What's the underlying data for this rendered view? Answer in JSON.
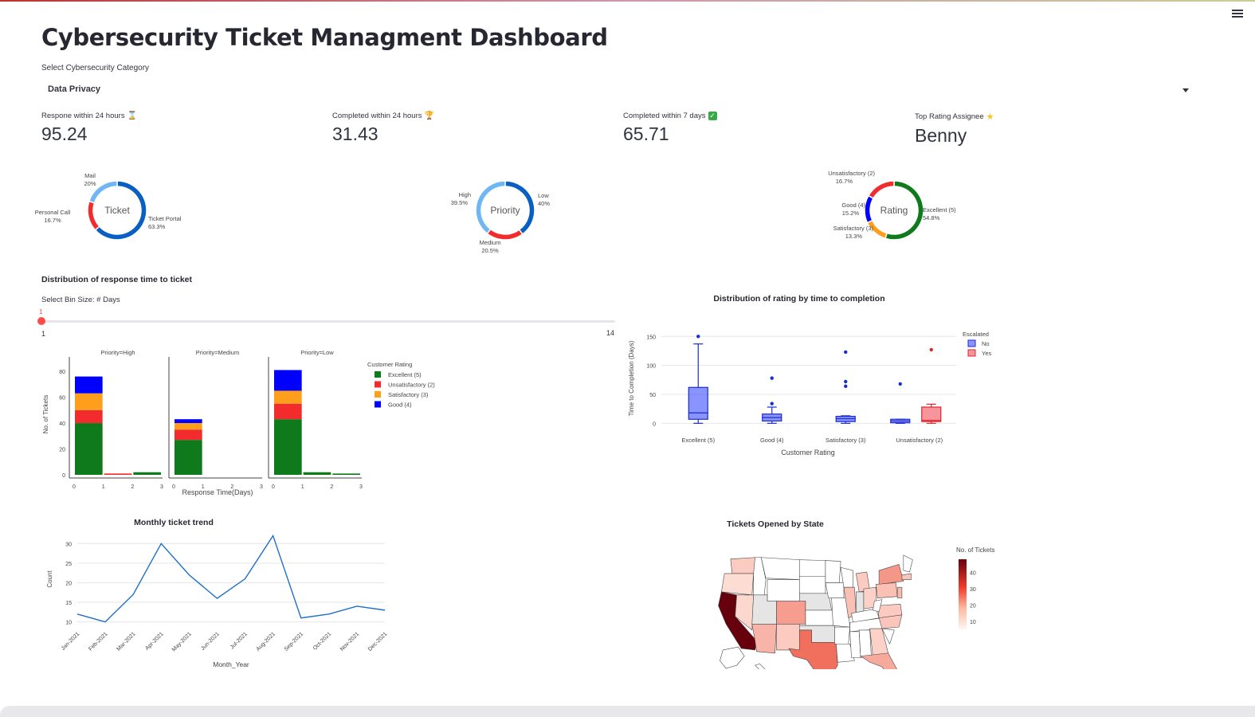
{
  "app": {
    "title": "Cybersecurity Ticket Managment Dashboard"
  },
  "icons": {
    "menu": "hamburger-menu-icon",
    "hourglass": "hourglass-icon",
    "trophy": "trophy-icon",
    "check": "check-mark-icon",
    "star": "star-icon",
    "caret": "chevron-down-icon"
  },
  "filter": {
    "label": "Select Cybersecurity Category",
    "value": "Data Privacy"
  },
  "metrics": [
    {
      "label": "Respone within 24 hours",
      "value": "95.24",
      "icon": "hourglass-icon"
    },
    {
      "label": "Completed within 24 hours",
      "value": "31.43",
      "icon": "trophy-icon"
    },
    {
      "label": "Completed within 7 days",
      "value": "65.71",
      "icon": "check-mark-icon"
    },
    {
      "label": "Top Rating Assignee",
      "value": "Benny",
      "icon": "star-icon"
    }
  ],
  "section": {
    "response_title": "Distribution of response time to ticket"
  },
  "slider": {
    "label": "Select Bin Size: # Days",
    "value": "1",
    "min": "1",
    "max": "14",
    "fraction": 0
  },
  "colors": {
    "dark_blue": "#0a5fc2",
    "light_blue": "#6fb6f5",
    "red": "#f22c2c",
    "green": "#0f7a1b",
    "orange": "#ff9e1b",
    "blue": "#0000ff",
    "line": "#1f6fc7"
  },
  "chart_data": [
    {
      "type": "pie",
      "hole": true,
      "center_label": "Ticket",
      "slices": [
        {
          "label": "Ticket Portal",
          "pct_label": "63.3%",
          "value": 63.3
        },
        {
          "label": "Personal Call",
          "pct_label": "16.7%",
          "value": 16.7
        },
        {
          "label": "Mail",
          "pct_label": "20%",
          "value": 20
        }
      ]
    },
    {
      "type": "pie",
      "hole": true,
      "center_label": "Priority",
      "slices": [
        {
          "label": "Low",
          "pct_label": "40%",
          "value": 40
        },
        {
          "label": "Medium",
          "pct_label": "20.5%",
          "value": 20.5
        },
        {
          "label": "High",
          "pct_label": "39.5%",
          "value": 39.5
        }
      ]
    },
    {
      "type": "pie",
      "hole": true,
      "center_label": "Rating",
      "slices": [
        {
          "label": "Excellent (5)",
          "pct_label": "54.8%",
          "value": 54.8
        },
        {
          "label": "Satisfactory (3)",
          "pct_label": "13.3%",
          "value": 13.3
        },
        {
          "label": "Good (4)",
          "pct_label": "15.2%",
          "value": 15.2
        },
        {
          "label": "Unsatisfactory (2)",
          "pct_label": "16.7%",
          "value": 16.7
        }
      ]
    },
    {
      "type": "bar",
      "stacked": true,
      "xlabel": "Response Time(Days)",
      "ylabel": "No. of Tickets",
      "ylim": [
        0,
        85
      ],
      "yticks": [
        0,
        20,
        40,
        60,
        80
      ],
      "xticks": [
        "0",
        "1",
        "2",
        "3"
      ],
      "legend_title": "Customer Rating",
      "legend": [
        "Excellent (5)",
        "Unsatisfactory (2)",
        "Satisfactory (3)",
        "Good (4)"
      ],
      "facets": [
        {
          "title": "Priority=High",
          "bins": [
            {
              "x0": 0,
              "x1": 1,
              "Excellent (5)": 40,
              "Unsatisfactory (2)": 10,
              "Satisfactory (3)": 13,
              "Good (4)": 13
            },
            {
              "x0": 1,
              "x1": 2,
              "Excellent (5)": 0,
              "Unsatisfactory (2)": 1,
              "Satisfactory (3)": 0,
              "Good (4)": 0
            },
            {
              "x0": 2,
              "x1": 3,
              "Excellent (5)": 2,
              "Unsatisfactory (2)": 0,
              "Satisfactory (3)": 0,
              "Good (4)": 0
            }
          ]
        },
        {
          "title": "Priority=Medium",
          "bins": [
            {
              "x0": 0,
              "x1": 1,
              "Excellent (5)": 27,
              "Unsatisfactory (2)": 8,
              "Satisfactory (3)": 5,
              "Good (4)": 3
            }
          ]
        },
        {
          "title": "Priority=Low",
          "bins": [
            {
              "x0": 0,
              "x1": 1,
              "Excellent (5)": 43,
              "Unsatisfactory (2)": 12,
              "Satisfactory (3)": 10,
              "Good (4)": 16
            },
            {
              "x0": 1,
              "x1": 2,
              "Excellent (5)": 2,
              "Unsatisfactory (2)": 0,
              "Satisfactory (3)": 0,
              "Good (4)": 0
            },
            {
              "x0": 2,
              "x1": 3,
              "Excellent (5)": 1,
              "Unsatisfactory (2)": 0,
              "Satisfactory (3)": 0,
              "Good (4)": 0
            }
          ]
        }
      ]
    },
    {
      "type": "box",
      "title": "Distribution of rating by time to completion",
      "xlabel": "Customer Rating",
      "ylabel": "Time to Completion (Days)",
      "ylim": [
        -5,
        160
      ],
      "yticks": [
        0,
        50,
        100,
        150
      ],
      "categories": [
        "Excellent (5)",
        "Good (4)",
        "Satisfactory (3)",
        "Unsatisfactory (2)"
      ],
      "legend_title": "Escalated",
      "series": [
        {
          "name": "No",
          "boxes": [
            {
              "cat": "Excellent (5)",
              "min": 0,
              "q1": 7,
              "median": 18,
              "q3": 62,
              "max": 137,
              "outliers": [
                150
              ]
            },
            {
              "cat": "Good (4)",
              "min": 0,
              "q1": 4,
              "median": 10,
              "q3": 16,
              "max": 28,
              "outliers": [
                34,
                78
              ]
            },
            {
              "cat": "Satisfactory (3)",
              "min": 0,
              "q1": 3,
              "median": 8,
              "q3": 12,
              "max": 13,
              "outliers": [
                64,
                72,
                123
              ]
            },
            {
              "cat": "Unsatisfactory (2)",
              "min": 0,
              "q1": 1,
              "median": 4,
              "q3": 7,
              "max": 7,
              "outliers": [
                68
              ]
            }
          ]
        },
        {
          "name": "Yes",
          "boxes": [
            {
              "cat": "Unsatisfactory (2)",
              "min": 0,
              "q1": 3,
              "median": 5,
              "q3": 28,
              "max": 33,
              "outliers": [
                127
              ]
            }
          ]
        }
      ]
    },
    {
      "type": "line",
      "title": "Monthly ticket trend",
      "xlabel": "Month_Year",
      "ylabel": "Count",
      "ylim": [
        8.5,
        32.5
      ],
      "yticks": [
        10,
        15,
        20,
        25,
        30
      ],
      "categories": [
        "Jan-2021",
        "Feb-2021",
        "Mar-2021",
        "Apr-2021",
        "May-2021",
        "Jun-2021",
        "Jul-2021",
        "Aug-2021",
        "Sep-2021",
        "Oct-2021",
        "Nov-2021",
        "Dec-2021"
      ],
      "values": [
        12,
        10,
        17,
        30,
        22,
        16,
        21,
        32,
        11,
        12,
        14,
        13
      ]
    },
    {
      "type": "choropleth",
      "title": "Tickets Opened by State",
      "colorbar_title": "No. of Tickets",
      "colorbar_ticks": [
        10,
        20,
        30,
        40
      ],
      "values": {
        "CA": 48,
        "TX": 22,
        "AZ": 10,
        "CO": 14,
        "OR": 3,
        "WA": 6,
        "NV": 4,
        "NM": 6,
        "FL": 12,
        "NY": 15,
        "PA": 8,
        "GA": 5,
        "NC": 7,
        "VA": 6,
        "IL": 8,
        "OH": 5,
        "MI": 6,
        "MA": 7,
        "NJ": 9
      }
    }
  ]
}
